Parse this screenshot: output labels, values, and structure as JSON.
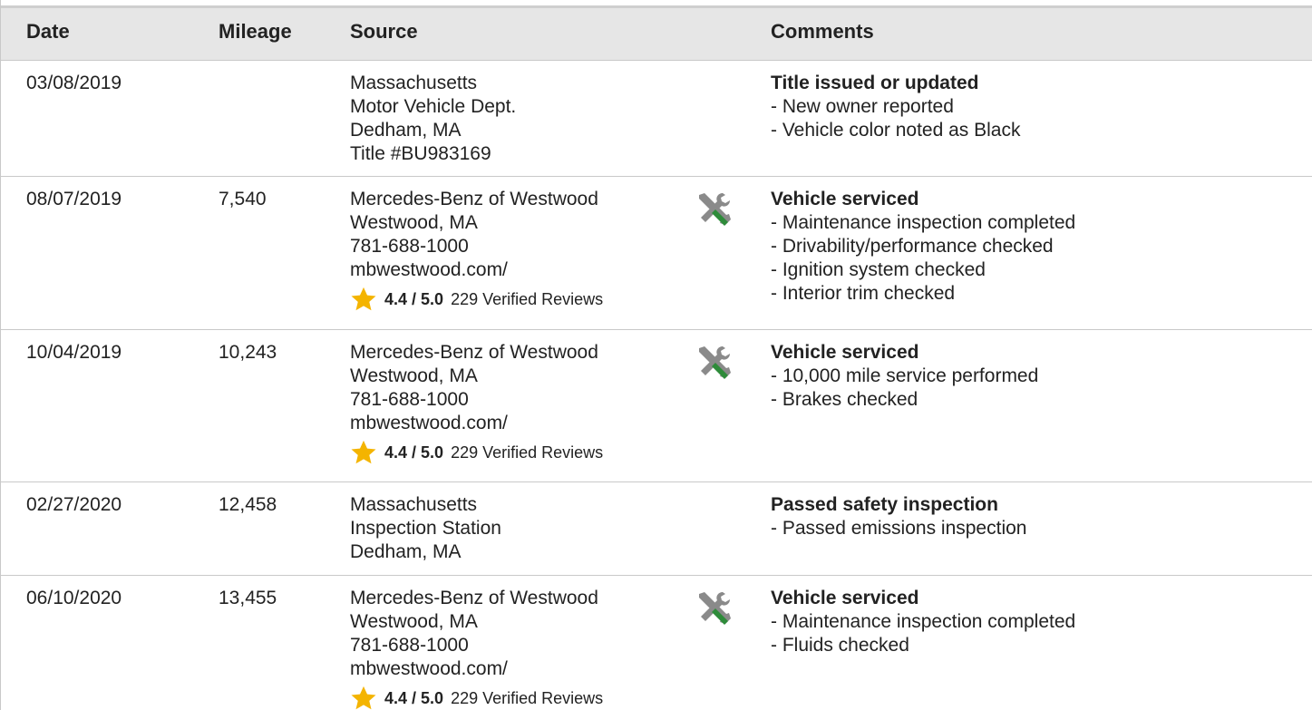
{
  "header": {
    "date": "Date",
    "mileage": "Mileage",
    "source": "Source",
    "comments": "Comments"
  },
  "colors": {
    "header_bg": "#e6e6e6",
    "border": "#c9c9c9",
    "star": "#f4b400",
    "wrench_gray": "#8a8a8a",
    "screwdriver_green": "#2e8b3a"
  },
  "rows": [
    {
      "date": "03/08/2019",
      "mileage": "",
      "source": [
        "Massachusetts",
        "Motor Vehicle Dept.",
        "Dedham, MA",
        "Title #BU983169"
      ],
      "service_icon": false,
      "rating": null,
      "comment_title": "Title issued or updated",
      "comment_items": [
        "- New owner reported",
        "- Vehicle color noted as Black"
      ]
    },
    {
      "date": "08/07/2019",
      "mileage": "7,540",
      "source": [
        "Mercedes-Benz of Westwood",
        "Westwood, MA",
        "781-688-1000",
        "mbwestwood.com/"
      ],
      "service_icon": true,
      "rating": {
        "score": "4.4 / 5.0",
        "reviews": "229 Verified Reviews"
      },
      "comment_title": "Vehicle serviced",
      "comment_items": [
        "- Maintenance inspection completed",
        "- Drivability/performance checked",
        "- Ignition system checked",
        "- Interior trim checked"
      ]
    },
    {
      "date": "10/04/2019",
      "mileage": "10,243",
      "source": [
        "Mercedes-Benz of Westwood",
        "Westwood, MA",
        "781-688-1000",
        "mbwestwood.com/"
      ],
      "service_icon": true,
      "rating": {
        "score": "4.4 / 5.0",
        "reviews": "229 Verified Reviews"
      },
      "comment_title": "Vehicle serviced",
      "comment_items": [
        "- 10,000 mile service performed",
        "- Brakes checked"
      ]
    },
    {
      "date": "02/27/2020",
      "mileage": "12,458",
      "source": [
        "Massachusetts",
        "Inspection Station",
        "Dedham, MA"
      ],
      "service_icon": false,
      "rating": null,
      "comment_title": "Passed safety inspection",
      "comment_items": [
        "- Passed emissions inspection"
      ]
    },
    {
      "date": "06/10/2020",
      "mileage": "13,455",
      "source": [
        "Mercedes-Benz of Westwood",
        "Westwood, MA",
        "781-688-1000",
        "mbwestwood.com/"
      ],
      "service_icon": true,
      "rating": {
        "score": "4.4 / 5.0",
        "reviews": "229 Verified Reviews"
      },
      "comment_title": "Vehicle serviced",
      "comment_items": [
        "- Maintenance inspection completed",
        "- Fluids checked"
      ]
    }
  ]
}
